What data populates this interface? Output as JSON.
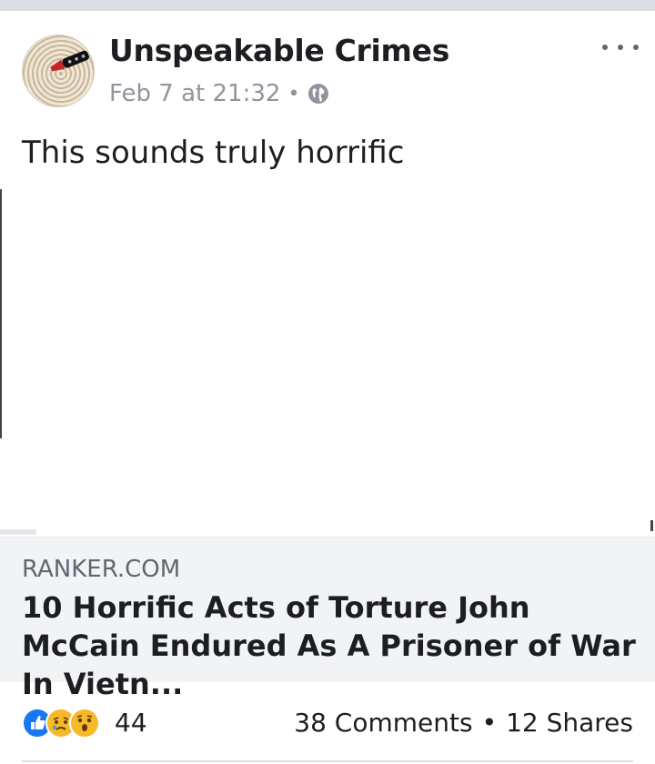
{
  "post": {
    "author": "Unspeakable Crimes",
    "timestamp": "Feb 7 at 21:32",
    "meta_separator": "•",
    "privacy_icon": "globe-icon",
    "more_icon": "more-options-icon",
    "text": "This sounds truly horrific"
  },
  "link": {
    "domain": "RANKER.COM",
    "title": "10 Horrific Acts of Torture John McCain Endured As A Prisoner of War In Vietn..."
  },
  "reactions": {
    "icons": [
      "like-icon",
      "sad-icon",
      "wow-icon"
    ],
    "count": "44",
    "comments": "38 Comments",
    "separator": "•",
    "shares": "12 Shares"
  },
  "colors": {
    "like": "#1877f2",
    "emoji": "#f7b928",
    "muted_text": "#90949c",
    "link_bg": "#f2f3f5"
  }
}
